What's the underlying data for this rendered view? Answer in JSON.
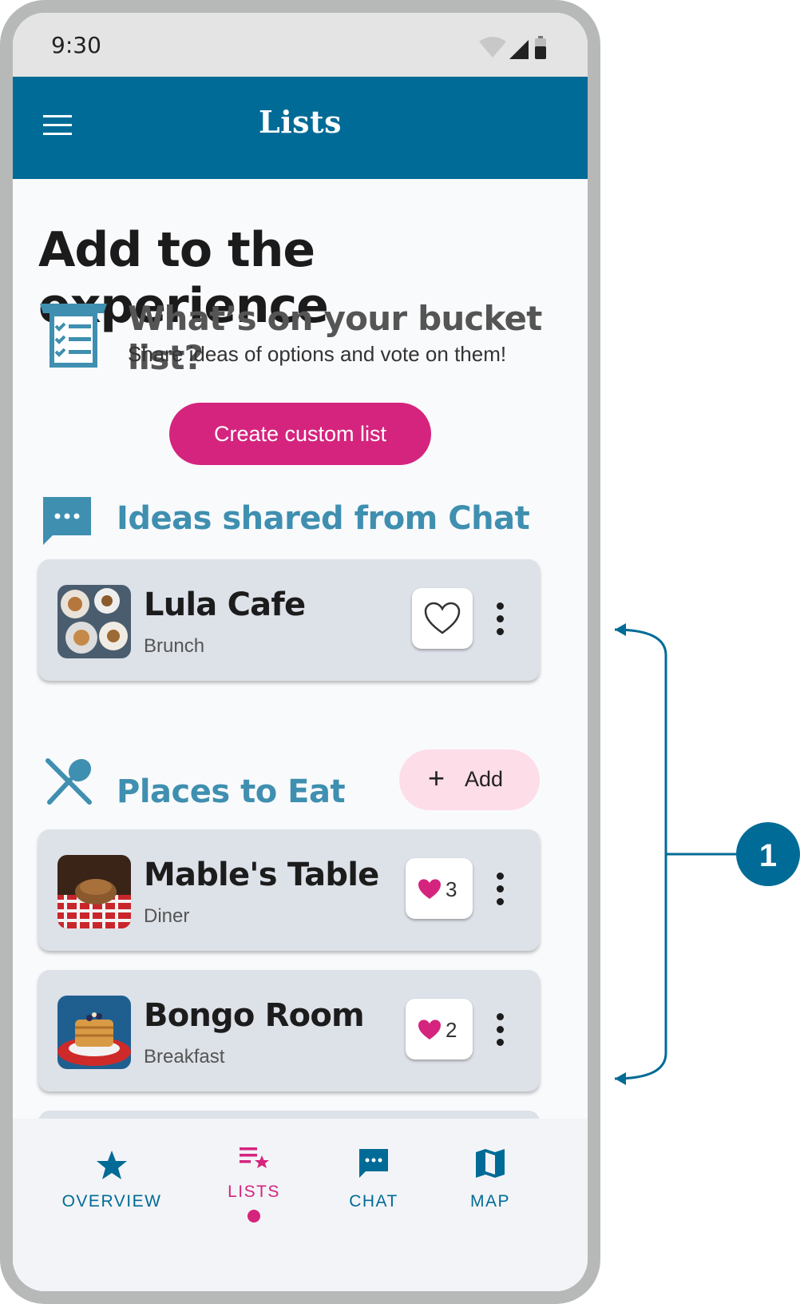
{
  "status": {
    "time": "9:30"
  },
  "appbar": {
    "title": "Lists"
  },
  "intro": {
    "heading": "Add to the experience",
    "title": "What’s on your bucket list?",
    "subtitle": "Share ideas of options and vote on them!",
    "create_button": "Create custom list"
  },
  "chat_section": {
    "title": "Ideas shared from Chat",
    "items": [
      {
        "name": "Lula Cafe",
        "type": "Brunch",
        "votes": ""
      }
    ]
  },
  "eat_section": {
    "title": "Places to Eat",
    "add_button": "Add",
    "items": [
      {
        "name": "Mable's Table",
        "type": "Diner",
        "votes": "3"
      },
      {
        "name": "Bongo Room",
        "type": "Breakfast",
        "votes": "2"
      }
    ]
  },
  "bottom_nav": [
    {
      "label": "OVERVIEW",
      "icon": "star-icon"
    },
    {
      "label": "LISTS",
      "icon": "list-star-icon",
      "active": true
    },
    {
      "label": "CHAT",
      "icon": "chat-bubble-icon"
    },
    {
      "label": "MAP",
      "icon": "map-icon"
    }
  ],
  "annotation": {
    "marker": "1"
  },
  "colors": {
    "primary": "#006b96",
    "accent": "#d4247e",
    "section_title": "#3f8fb0",
    "card": "#dde1e8",
    "add_button_bg": "#fddde7"
  }
}
